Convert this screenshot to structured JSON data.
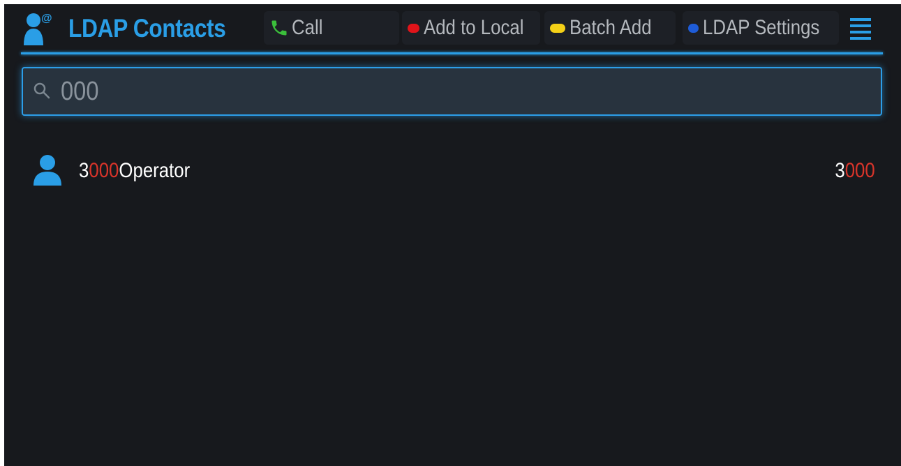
{
  "header": {
    "title": "LDAP Contacts",
    "softkeys": {
      "call": "Call",
      "add_to_local": "Add to Local",
      "batch_add": "Batch Add",
      "ldap_settings": "LDAP Settings"
    }
  },
  "search": {
    "value": "000",
    "icon": "search-icon"
  },
  "contacts": [
    {
      "name_prefix": "3",
      "name_match": "000",
      "name_suffix": "Operator",
      "number_prefix": "3",
      "number_match": "000",
      "icon": "person-icon"
    }
  ],
  "colors": {
    "accent": "#2a9ee6",
    "background": "#17191d",
    "highlight": "#d8342a",
    "call_icon": "#3bbf3b",
    "key_red": "#e0141a",
    "key_yellow": "#f4d017",
    "key_blue": "#1e5cd8"
  }
}
